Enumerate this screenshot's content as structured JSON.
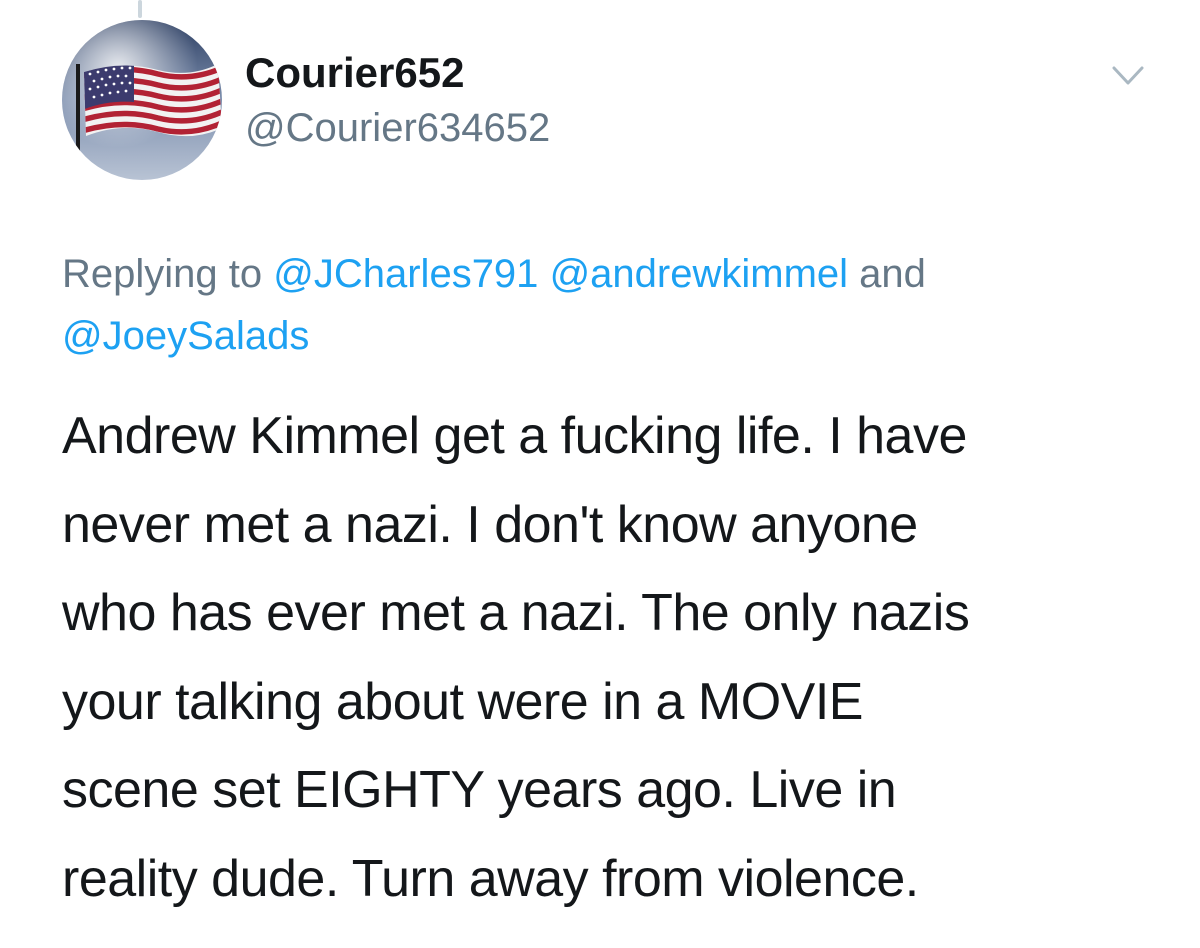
{
  "author": {
    "display_name": "Courier652",
    "handle": "@Courier634652",
    "avatar_icon": "american-flag-avatar"
  },
  "menu": {
    "icon": "chevron-down-icon"
  },
  "reply_context": {
    "prefix": "Replying to",
    "mentions": [
      "@JCharles791",
      "@andrewkimmel",
      "@JoeySalads"
    ],
    "conjunction": "and"
  },
  "tweet": {
    "lines": [
      "Andrew Kimmel get a fucking life. I have",
      "never met a nazi. I don't know anyone",
      "who has ever met a nazi. The only nazis",
      "your talking about were in a MOVIE",
      "scene set EIGHTY years ago. Live in",
      "reality dude. Turn away from violence."
    ]
  },
  "colors": {
    "text": "#14171a",
    "secondary": "#657786",
    "link": "#1da1f2",
    "thread_line": "#ccd6dd"
  }
}
